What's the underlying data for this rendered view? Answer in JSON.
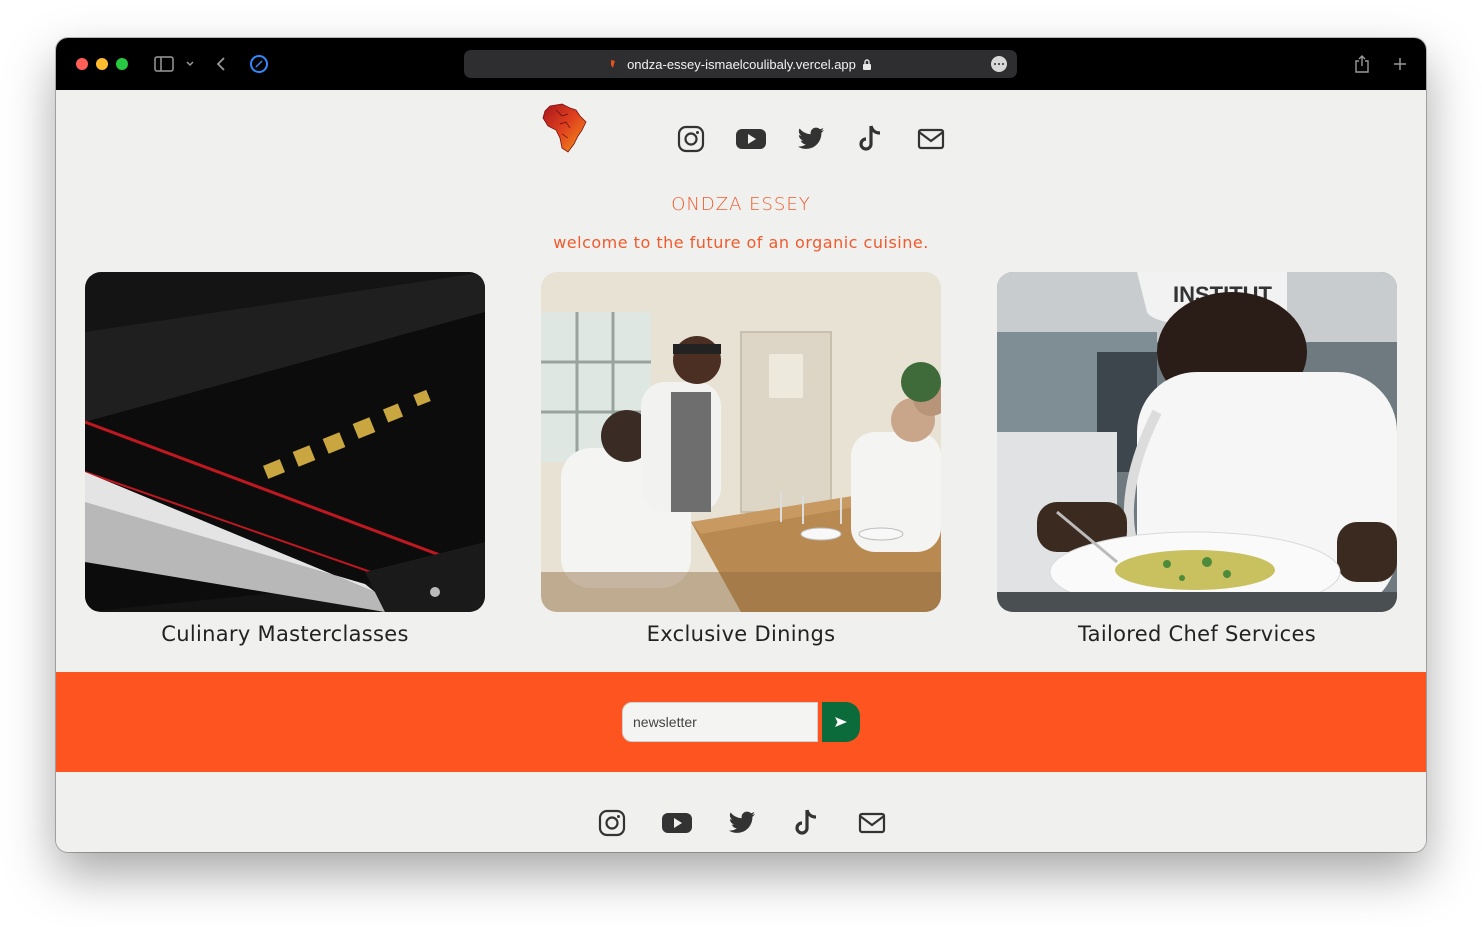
{
  "browser": {
    "url": "ondza-essey-ismaelcoulibaly.vercel.app"
  },
  "header": {
    "logo_icon": "africa-map-logo",
    "social_icons": [
      "instagram-icon",
      "youtube-icon",
      "twitter-icon",
      "tiktok-icon",
      "mail-icon"
    ]
  },
  "hero": {
    "brand": "ONDZA ESSEY",
    "tagline": "welcome to the future of an organic cuisine."
  },
  "services": [
    {
      "caption": "Culinary Masterclasses",
      "image": "chef-knife-photo"
    },
    {
      "caption": "Exclusive Dinings",
      "image": "dining-table-photo"
    },
    {
      "caption": "Tailored Chef Services",
      "image": "chef-plating-photo"
    }
  ],
  "newsletter": {
    "placeholder": "newsletter",
    "submit_icon": "send-arrow-icon"
  },
  "footer": {
    "social_icons": [
      "instagram-icon",
      "youtube-icon",
      "twitter-icon",
      "tiktok-icon",
      "mail-icon"
    ]
  },
  "colors": {
    "accent": "#f05a2c",
    "newsletter_bar": "#fe5520",
    "submit_button": "#0b6b3a",
    "page_bg": "#f0f0ee"
  }
}
